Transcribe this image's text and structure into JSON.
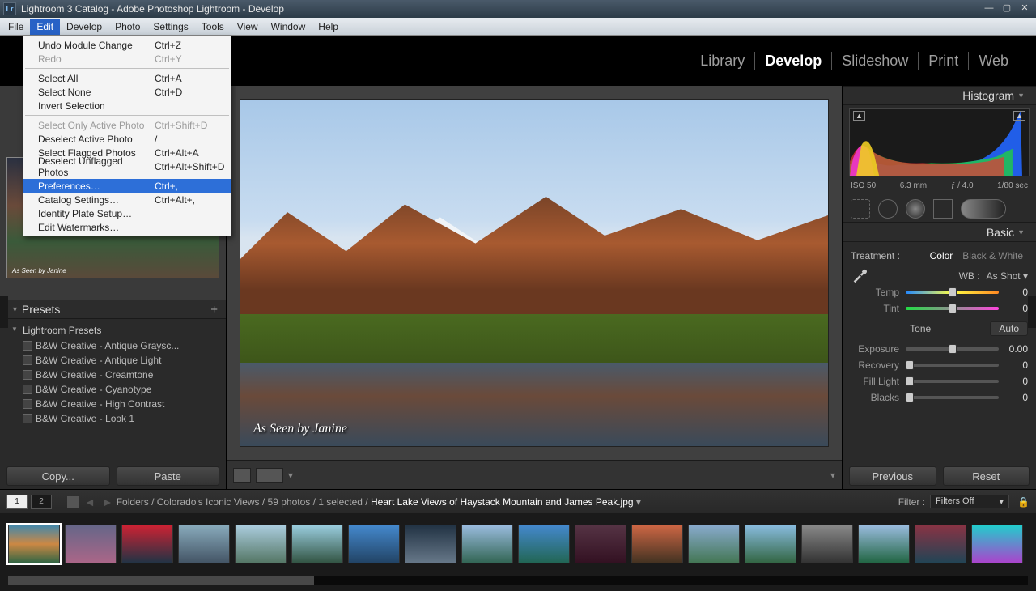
{
  "window": {
    "title": "Lightroom 3 Catalog - Adobe Photoshop Lightroom - Develop"
  },
  "menubar": [
    "File",
    "Edit",
    "Develop",
    "Photo",
    "Settings",
    "Tools",
    "View",
    "Window",
    "Help"
  ],
  "menubar_open_index": 1,
  "edit_menu": {
    "section1": [
      {
        "label": "Undo Module Change",
        "shortcut": "Ctrl+Z",
        "disabled": false
      },
      {
        "label": "Redo",
        "shortcut": "Ctrl+Y",
        "disabled": true
      }
    ],
    "section2": [
      {
        "label": "Select All",
        "shortcut": "Ctrl+A"
      },
      {
        "label": "Select None",
        "shortcut": "Ctrl+D"
      },
      {
        "label": "Invert Selection",
        "shortcut": ""
      }
    ],
    "section3": [
      {
        "label": "Select Only Active Photo",
        "shortcut": "Ctrl+Shift+D",
        "disabled": true
      },
      {
        "label": "Deselect Active Photo",
        "shortcut": "/"
      },
      {
        "label": "Select Flagged Photos",
        "shortcut": "Ctrl+Alt+A"
      },
      {
        "label": "Deselect Unflagged Photos",
        "shortcut": "Ctrl+Alt+Shift+D"
      }
    ],
    "section4": [
      {
        "label": "Preferences…",
        "shortcut": "Ctrl+,",
        "selected": true
      },
      {
        "label": "Catalog Settings…",
        "shortcut": "Ctrl+Alt+,"
      },
      {
        "label": "Identity Plate Setup…",
        "shortcut": ""
      },
      {
        "label": "Edit Watermarks…",
        "shortcut": ""
      }
    ]
  },
  "modules": [
    "Library",
    "Develop",
    "Slideshow",
    "Print",
    "Web"
  ],
  "module_active": "Develop",
  "left": {
    "nav_caption": "As Seen by Janine",
    "presets_header": "Presets",
    "presets_group": "Lightroom Presets",
    "presets": [
      "B&W Creative - Antique Graysc...",
      "B&W Creative - Antique Light",
      "B&W Creative - Creamtone",
      "B&W Creative - Cyanotype",
      "B&W Creative - High Contrast",
      "B&W Creative - Look 1"
    ],
    "copy": "Copy...",
    "paste": "Paste"
  },
  "center": {
    "caption": "As Seen by Janine"
  },
  "right": {
    "histogram": "Histogram",
    "hist_meta": {
      "iso": "ISO 50",
      "focal": "6.3 mm",
      "aperture": "ƒ / 4.0",
      "shutter": "1/80 sec"
    },
    "basic": "Basic",
    "treatment_label": "Treatment :",
    "treatment_color": "Color",
    "treatment_bw": "Black & White",
    "wb_label": "WB :",
    "wb_value": "As Shot",
    "temp_label": "Temp",
    "temp_val": "0",
    "tint_label": "Tint",
    "tint_val": "0",
    "tone_label": "Tone",
    "auto": "Auto",
    "exposure_label": "Exposure",
    "exposure_val": "0.00",
    "recovery_label": "Recovery",
    "recovery_val": "0",
    "fill_label": "Fill Light",
    "fill_val": "0",
    "blacks_label": "Blacks",
    "blacks_val": "0",
    "previous": "Previous",
    "reset": "Reset"
  },
  "filmstrip_header": {
    "monitor1": "1",
    "monitor2": "2",
    "path_prefix": "Folders / Colorado's Iconic Views / 59 photos / 1 selected / ",
    "filename": "Heart Lake Views of Haystack Mountain and James Peak.jpg",
    "filter_label": "Filter :",
    "filter_value": "Filters Off"
  },
  "thumb_count": 18
}
